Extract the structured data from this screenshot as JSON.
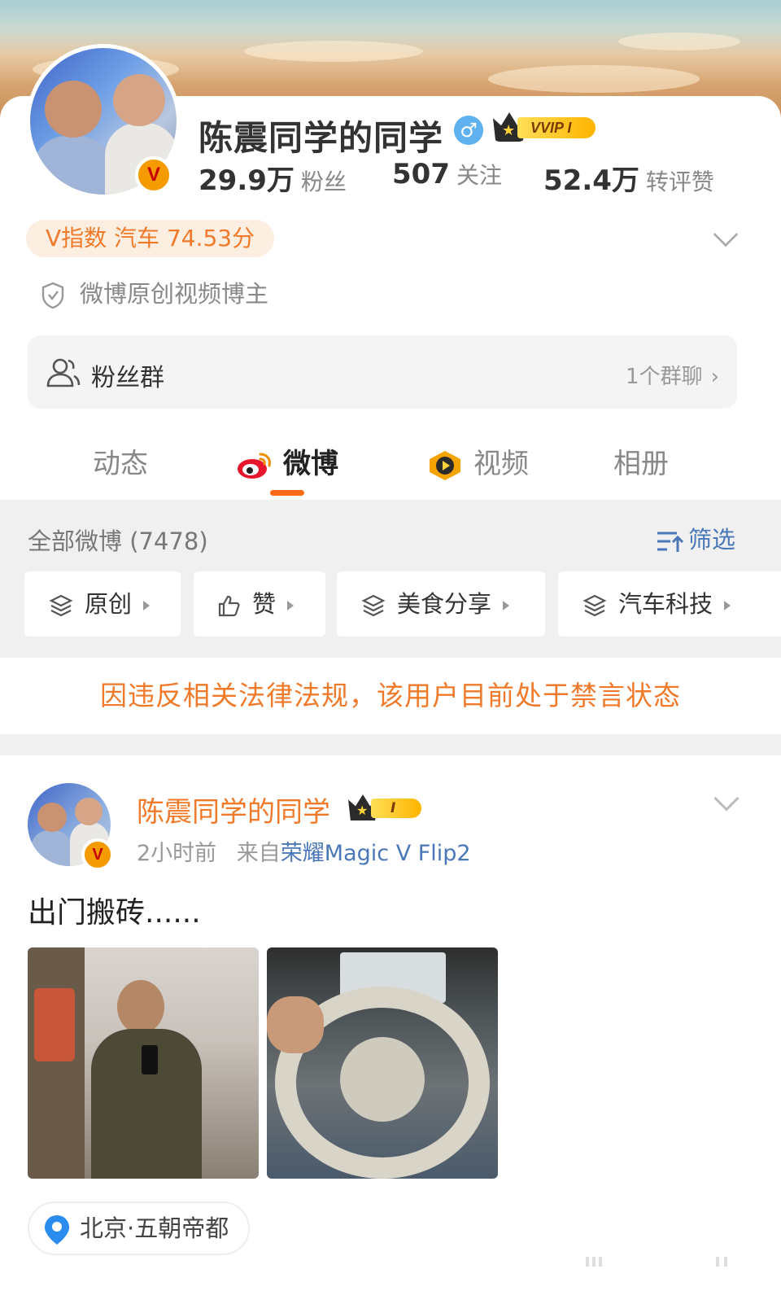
{
  "profile": {
    "name": "陈震同学的同学",
    "gender_symbol": "♂",
    "vip_label": "VVIP",
    "vip_level": "I",
    "followers_num": "29.9万",
    "followers_label": "粉丝",
    "following_num": "507",
    "following_label": "关注",
    "interactions_num": "52.4万",
    "interactions_label": "转评赞",
    "v_index": "V指数 汽车 74.53分",
    "creator_tag": "微博原创视频博主",
    "verify_badge": "V"
  },
  "fan_group": {
    "label": "粉丝群",
    "right_text": "1个群聊"
  },
  "tabs": [
    {
      "label": "动态"
    },
    {
      "label": "微博"
    },
    {
      "label": "视频"
    },
    {
      "label": "相册"
    }
  ],
  "filter": {
    "all_label": "全部微博 (7478)",
    "filter_label": "筛选",
    "chips": [
      {
        "label": "原创"
      },
      {
        "label": "赞"
      },
      {
        "label": "美食分享"
      },
      {
        "label": "汽车科技"
      }
    ]
  },
  "ban_notice": "因违反相关法律法规，该用户目前处于禁言状态",
  "post": {
    "author": "陈震同学的同学",
    "vip_level": "I",
    "time": "2小时前",
    "from_label": "来自",
    "source": "荣耀Magic V Flip2",
    "text": "出门搬砖......",
    "location": "北京·五朝帝都"
  },
  "colors": {
    "accent_orange": "#f07a2a",
    "link_blue": "#4a77b8",
    "tab_underline": "#ff6a17"
  },
  "icons": [
    "shield-icon",
    "fan-group-icon",
    "weibo-logo-icon",
    "video-icon",
    "filter-icon",
    "layers-icon",
    "thumbs-up-icon",
    "location-pin-icon",
    "chevron-down-icon",
    "chevron-right-icon"
  ]
}
